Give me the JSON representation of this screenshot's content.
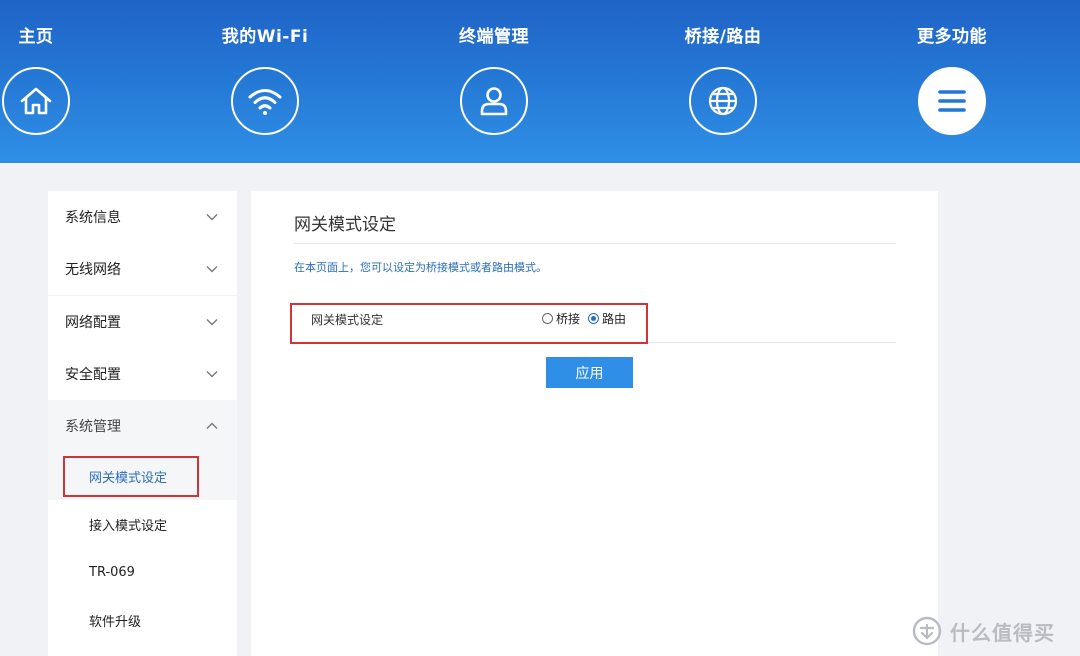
{
  "topnav": {
    "items": [
      {
        "label": "主页",
        "icon": "home-icon"
      },
      {
        "label": "我的Wi-Fi",
        "icon": "wifi-icon"
      },
      {
        "label": "终端管理",
        "icon": "user-icon"
      },
      {
        "label": "桥接/路由",
        "icon": "globe-icon"
      },
      {
        "label": "更多功能",
        "icon": "menu-icon",
        "active": true
      }
    ]
  },
  "sidebar": {
    "items": [
      {
        "label": "系统信息",
        "state": "collapsed"
      },
      {
        "label": "无线网络",
        "state": "collapsed"
      },
      {
        "label": "网络配置",
        "state": "collapsed"
      },
      {
        "label": "安全配置",
        "state": "collapsed"
      },
      {
        "label": "系统管理",
        "state": "expanded"
      }
    ],
    "subitems": [
      {
        "label": "网关模式设定",
        "active": true
      },
      {
        "label": "接入模式设定"
      },
      {
        "label": "TR-069"
      },
      {
        "label": "软件升级"
      }
    ]
  },
  "main": {
    "title": "网关模式设定",
    "description": "在本页面上，您可以设定为桥接模式或者路由模式。",
    "field_label": "网关模式设定",
    "options": [
      {
        "label": "桥接",
        "checked": false
      },
      {
        "label": "路由",
        "checked": true
      }
    ],
    "apply_label": "应用"
  },
  "watermark": {
    "text": "什么值得买",
    "logo": "smzdm-logo-icon"
  },
  "colors": {
    "nav_gradient_top": "#1f63c6",
    "nav_gradient_bottom": "#2f8fe6",
    "accent": "#2a6ebd",
    "button": "#2f8fe6",
    "highlight": "#d0333a"
  }
}
